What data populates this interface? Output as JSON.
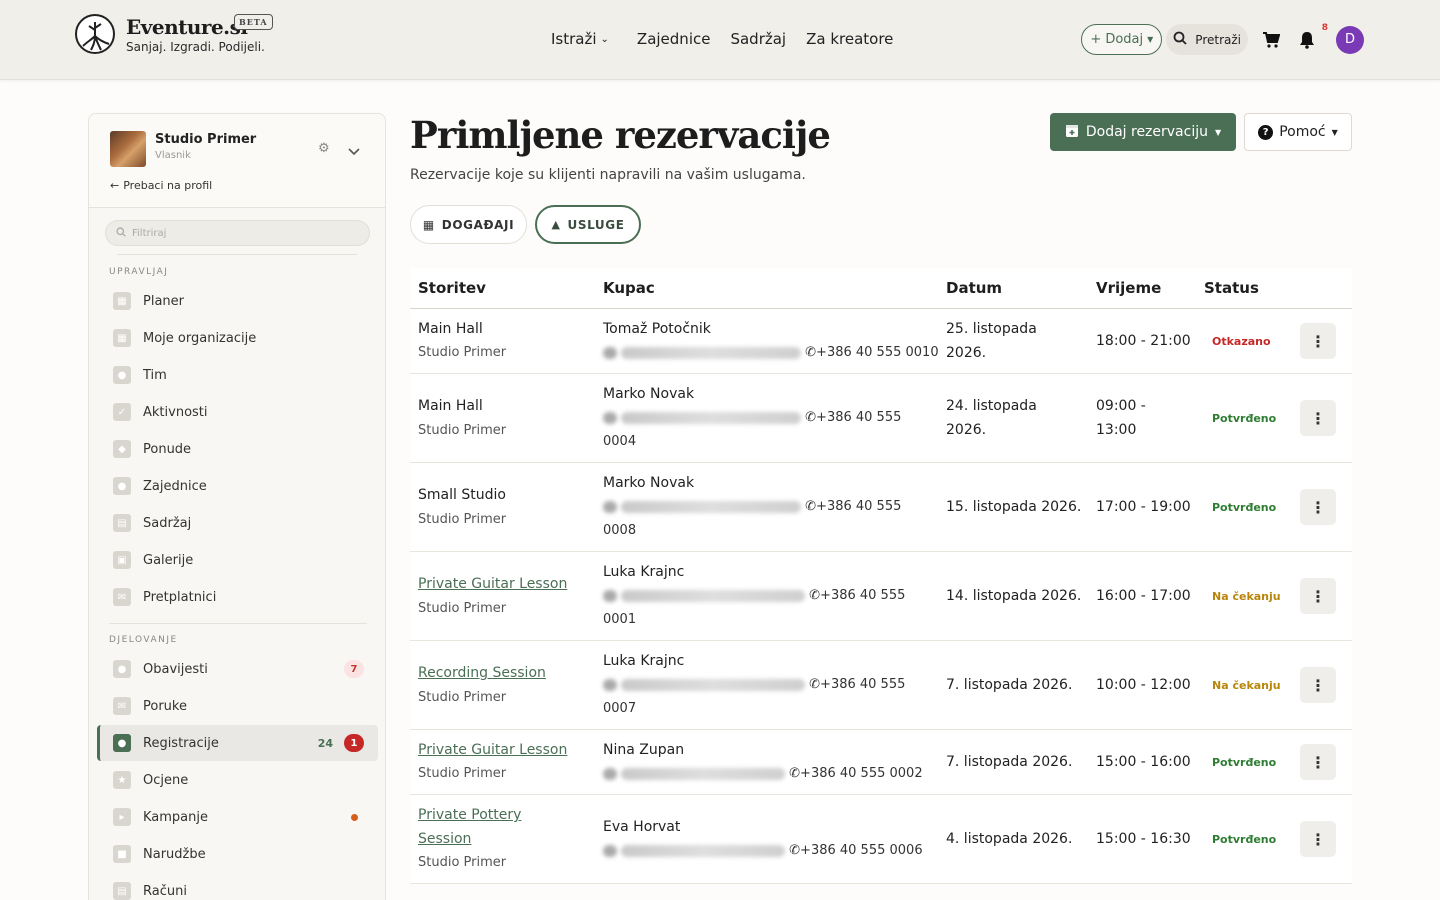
{
  "header": {
    "brand": "Eventure.si",
    "tagline": "Sanjaj. Izgradi. Podijeli.",
    "beta": "BETA",
    "nav": [
      "Istraži",
      "Zajednice",
      "Sadržaj",
      "Za kreatore"
    ],
    "add_label": "+ Dodaj",
    "search_label": "Pretraži",
    "notifications_count": "8",
    "avatar_initial": "D"
  },
  "sidebar": {
    "profile_name": "Studio Primer",
    "profile_role": "Vlasnik",
    "switch_profile": "Prebaci na profil",
    "filter_placeholder": "Filtriraj",
    "section_manage": "UPRAVLJAJ",
    "section_operate": "DJELOVANJE",
    "manage_items": [
      "Planer",
      "Moje organizacije",
      "Tim",
      "Aktivnosti",
      "Ponude",
      "Zajednice",
      "Sadržaj",
      "Galerije",
      "Pretplatnici"
    ],
    "operate_items": [
      "Obavijesti",
      "Poruke",
      "Registracije",
      "Ocjene",
      "Kampanje",
      "Narudžbe",
      "Računi"
    ],
    "notifications_badge": "7",
    "registrations_count": "24",
    "registrations_badge": "1"
  },
  "main": {
    "title": "Primljene rezervacije",
    "subtitle": "Rezervacije koje su klijenti napravili na vašim uslugama.",
    "add_button": "Dodaj rezervaciju",
    "help_button": "Pomoć",
    "tabs": [
      "DOGAĐAJI",
      "USLUGE"
    ],
    "columns": [
      "Storitev",
      "Kupac",
      "Datum",
      "Vrijeme",
      "Status"
    ],
    "rows": [
      {
        "service": "Main Hall",
        "org": "Studio Primer",
        "customer": "Tomaž Potočnik",
        "phone": "+386 40 555 0010",
        "date": "25. listopada 2026.",
        "time": "18:00 - 21:00",
        "status": "Otkazano"
      },
      {
        "service": "Main Hall",
        "org": "Studio Primer",
        "customer": "Marko Novak",
        "phone": "+386 40 555 0004",
        "date": "24. listopada 2026.",
        "time": "09:00 - 13:00",
        "status": "Potvrđeno"
      },
      {
        "service": "Small Studio",
        "org": "Studio Primer",
        "customer": "Marko Novak",
        "phone": "+386 40 555 0008",
        "date": "15. listopada 2026.",
        "time": "17:00 - 19:00",
        "status": "Potvrđeno"
      },
      {
        "service": "Private Guitar Lesson",
        "org": "Studio Primer",
        "customer": "Luka Krajnc",
        "phone": "+386 40 555 0001",
        "date": "14. listopada 2026.",
        "time": "16:00 - 17:00",
        "status": "Na čekanju"
      },
      {
        "service": "Recording Session",
        "org": "Studio Primer",
        "customer": "Luka Krajnc",
        "phone": "+386 40 555 0007",
        "date": "7. listopada 2026.",
        "time": "10:00 - 12:00",
        "status": "Na čekanju"
      },
      {
        "service": "Private Guitar Lesson",
        "org": "Studio Primer",
        "customer": "Nina Zupan",
        "phone": "+386 40 555 0002",
        "date": "7. listopada 2026.",
        "time": "15:00 - 16:00",
        "status": "Potvrđeno"
      },
      {
        "service": "Private Pottery Session",
        "org": "Studio Primer",
        "customer": "Eva Horvat",
        "phone": "+386 40 555 0006",
        "date": "4. listopada 2026.",
        "time": "15:00 - 16:30",
        "status": "Potvrđeno"
      }
    ]
  },
  "colors": {
    "accent": "#4b6f55",
    "danger": "#c62828",
    "pending": "#b8860b",
    "success": "#2e7d32"
  }
}
